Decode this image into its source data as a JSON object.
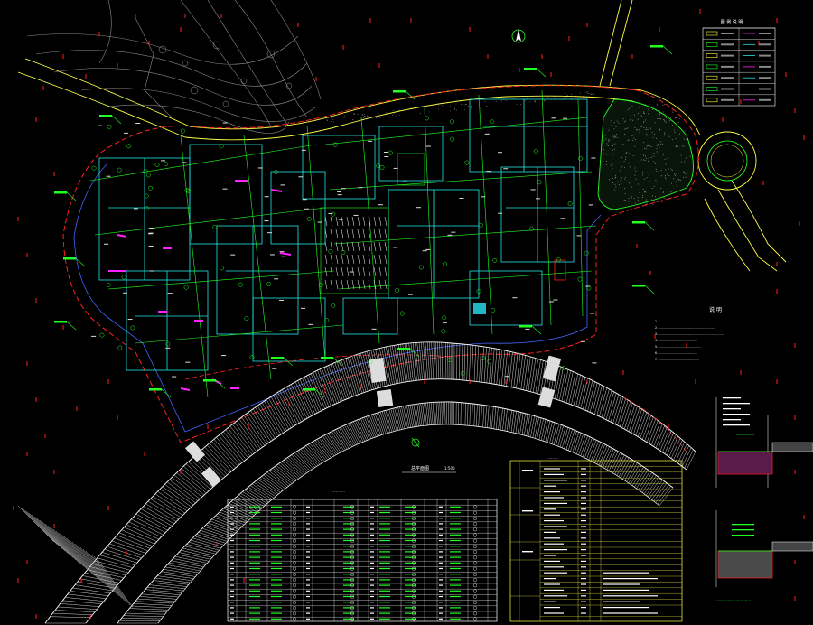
{
  "drawing": {
    "background": "#000000",
    "colors": {
      "red": "#ff2020",
      "green": "#22ff22",
      "yellow": "#ffff44",
      "cyan": "#22e5e5",
      "white": "#ffffff",
      "magenta": "#ff22ff",
      "blue": "#4466ff",
      "gray": "#8a8a8a"
    },
    "notes_title": "说 明",
    "notes_lines": [
      "1. ........................................................................",
      "2. ..............................................................",
      "3. ........................................................................",
      "4. ..........................................",
      "5. ..............................................",
      "6. ..........................................",
      "7. ............................................"
    ],
    "plan_title": "总平面图",
    "plan_scale": "1:500",
    "schedule_title": "...........",
    "detail1_title": "..............................",
    "detail2_title": "..............................",
    "legend_title": "图 例 说 明"
  }
}
